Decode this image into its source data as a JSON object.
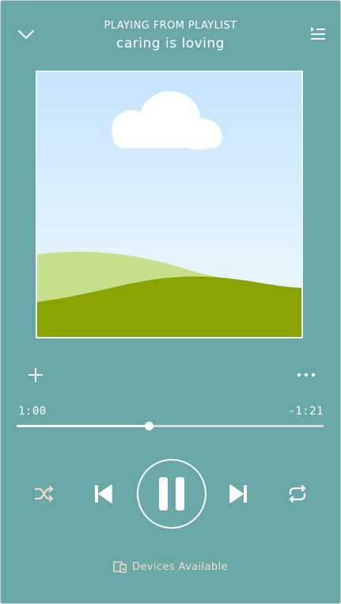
{
  "header": {
    "playing_from_label": "PLAYING FROM PLAYLIST",
    "playlist_name": "caring is loving"
  },
  "playback": {
    "elapsed": "1:00",
    "remaining": "-1:21",
    "progress_fraction": 0.43,
    "is_playing": true
  },
  "footer": {
    "devices_label": "Devices Available"
  },
  "icons": {
    "collapse": "chevron-down-icon",
    "queue": "queue-list-icon",
    "add": "plus-icon",
    "more": "more-horizontal-icon",
    "shuffle": "shuffle-icon",
    "previous": "skip-previous-icon",
    "pause": "pause-icon",
    "next": "skip-next-icon",
    "repeat": "repeat-icon",
    "devices": "devices-icon"
  },
  "colors": {
    "background": "#6aa8a8",
    "accent": "#f2d9c9",
    "foreground": "#ffffff"
  }
}
